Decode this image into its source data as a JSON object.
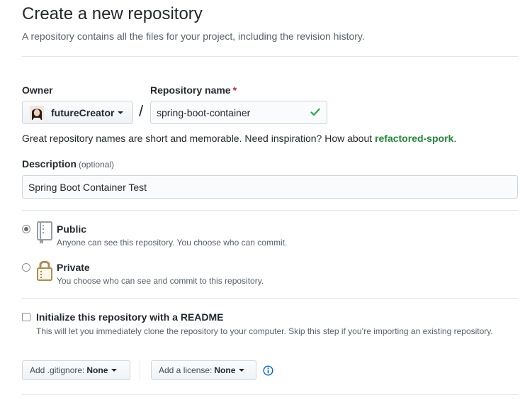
{
  "header": {
    "title": "Create a new repository",
    "subtitle": "A repository contains all the files for your project, including the revision history."
  },
  "owner": {
    "label": "Owner",
    "name": "futureCreator"
  },
  "repository": {
    "label": "Repository name",
    "required_mark": "*",
    "separator": "/",
    "value": "spring-boot-container",
    "valid_icon": "check-icon",
    "hint_text": "Great repository names are short and memorable. Need inspiration? How about ",
    "suggestion": "refactored-spork",
    "hint_end": "."
  },
  "description": {
    "label": "Description",
    "optional": "(optional)",
    "value": "Spring Boot Container Test"
  },
  "visibility": {
    "selected": "public",
    "options": [
      {
        "id": "public",
        "title": "Public",
        "description": "Anyone can see this repository. You choose who can commit.",
        "icon": "repo-icon"
      },
      {
        "id": "private",
        "title": "Private",
        "description": "You choose who can see and commit to this repository.",
        "icon": "lock-icon"
      }
    ]
  },
  "init": {
    "checked": false,
    "title": "Initialize this repository with a README",
    "description": "This will let you immediately clone the repository to your computer. Skip this step if you’re importing an existing repository."
  },
  "gitignore": {
    "label": "Add .gitignore:",
    "value": "None"
  },
  "license": {
    "label": "Add a license:",
    "value": "None",
    "info_icon": "info-icon"
  },
  "colors": {
    "accent_green": "#22863a",
    "check_green": "#28a745",
    "required_red": "#cb2431",
    "info_blue": "#0366d6",
    "icon_tan": "#b08b4f"
  }
}
